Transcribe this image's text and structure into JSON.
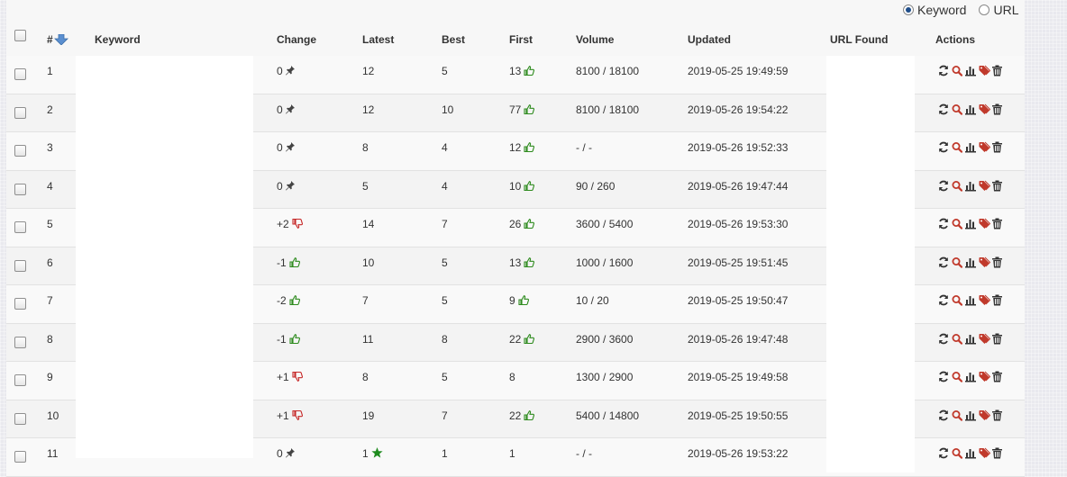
{
  "toggle": {
    "options": [
      {
        "label": "Keyword",
        "selected": true
      },
      {
        "label": "URL",
        "selected": false
      }
    ]
  },
  "table": {
    "columns": {
      "num": "#",
      "keyword": "Keyword",
      "change": "Change",
      "latest": "Latest",
      "best": "Best",
      "first": "First",
      "volume": "Volume",
      "updated": "Updated",
      "url_found": "URL Found",
      "actions": "Actions"
    },
    "rows": [
      {
        "num": "1",
        "change": "0",
        "change_icon": "pin",
        "latest": "12",
        "latest_icon": "",
        "best": "5",
        "first": "13",
        "first_icon": "up",
        "volume": "8100 / 18100",
        "updated": "2019-05-25 19:49:59"
      },
      {
        "num": "2",
        "change": "0",
        "change_icon": "pin",
        "latest": "12",
        "latest_icon": "",
        "best": "10",
        "first": "77",
        "first_icon": "up",
        "volume": "8100 / 18100",
        "updated": "2019-05-26 19:54:22"
      },
      {
        "num": "3",
        "change": "0",
        "change_icon": "pin",
        "latest": "8",
        "latest_icon": "",
        "best": "4",
        "first": "12",
        "first_icon": "up",
        "volume": "- / -",
        "updated": "2019-05-26 19:52:33"
      },
      {
        "num": "4",
        "change": "0",
        "change_icon": "pin",
        "latest": "5",
        "latest_icon": "",
        "best": "4",
        "first": "10",
        "first_icon": "up",
        "volume": "90 / 260",
        "updated": "2019-05-26 19:47:44"
      },
      {
        "num": "5",
        "change": "+2",
        "change_icon": "down",
        "latest": "14",
        "latest_icon": "",
        "best": "7",
        "first": "26",
        "first_icon": "up",
        "volume": "3600 / 5400",
        "updated": "2019-05-26 19:53:30"
      },
      {
        "num": "6",
        "change": "-1",
        "change_icon": "up",
        "latest": "10",
        "latest_icon": "",
        "best": "5",
        "first": "13",
        "first_icon": "up",
        "volume": "1000 / 1600",
        "updated": "2019-05-25 19:51:45"
      },
      {
        "num": "7",
        "change": "-2",
        "change_icon": "up",
        "latest": "7",
        "latest_icon": "",
        "best": "5",
        "first": "9",
        "first_icon": "up",
        "volume": "10 / 20",
        "updated": "2019-05-25 19:50:47"
      },
      {
        "num": "8",
        "change": "-1",
        "change_icon": "up",
        "latest": "11",
        "latest_icon": "",
        "best": "8",
        "first": "22",
        "first_icon": "up",
        "volume": "2900 / 3600",
        "updated": "2019-05-26 19:47:48"
      },
      {
        "num": "9",
        "change": "+1",
        "change_icon": "down",
        "latest": "8",
        "latest_icon": "",
        "best": "5",
        "first": "8",
        "first_icon": "",
        "volume": "1300 / 2900",
        "updated": "2019-05-25 19:49:58"
      },
      {
        "num": "10",
        "change": "+1",
        "change_icon": "down",
        "latest": "19",
        "latest_icon": "",
        "best": "7",
        "first": "22",
        "first_icon": "up",
        "volume": "5400 / 14800",
        "updated": "2019-05-25 19:50:55"
      },
      {
        "num": "11",
        "change": "0",
        "change_icon": "pin",
        "latest": "1",
        "latest_icon": "star",
        "best": "1",
        "first": "1",
        "first_icon": "",
        "volume": "- / -",
        "updated": "2019-05-26 19:53:22"
      }
    ],
    "row_actions": [
      "refresh-icon",
      "search-icon",
      "chart-icon",
      "tag-icon",
      "trash-icon"
    ]
  },
  "colors": {
    "up": "#2e8b1e",
    "down": "#c62828",
    "sort_arrow": "#5b8fd0",
    "action_dark": "#333333",
    "action_red": "#c0392b"
  }
}
